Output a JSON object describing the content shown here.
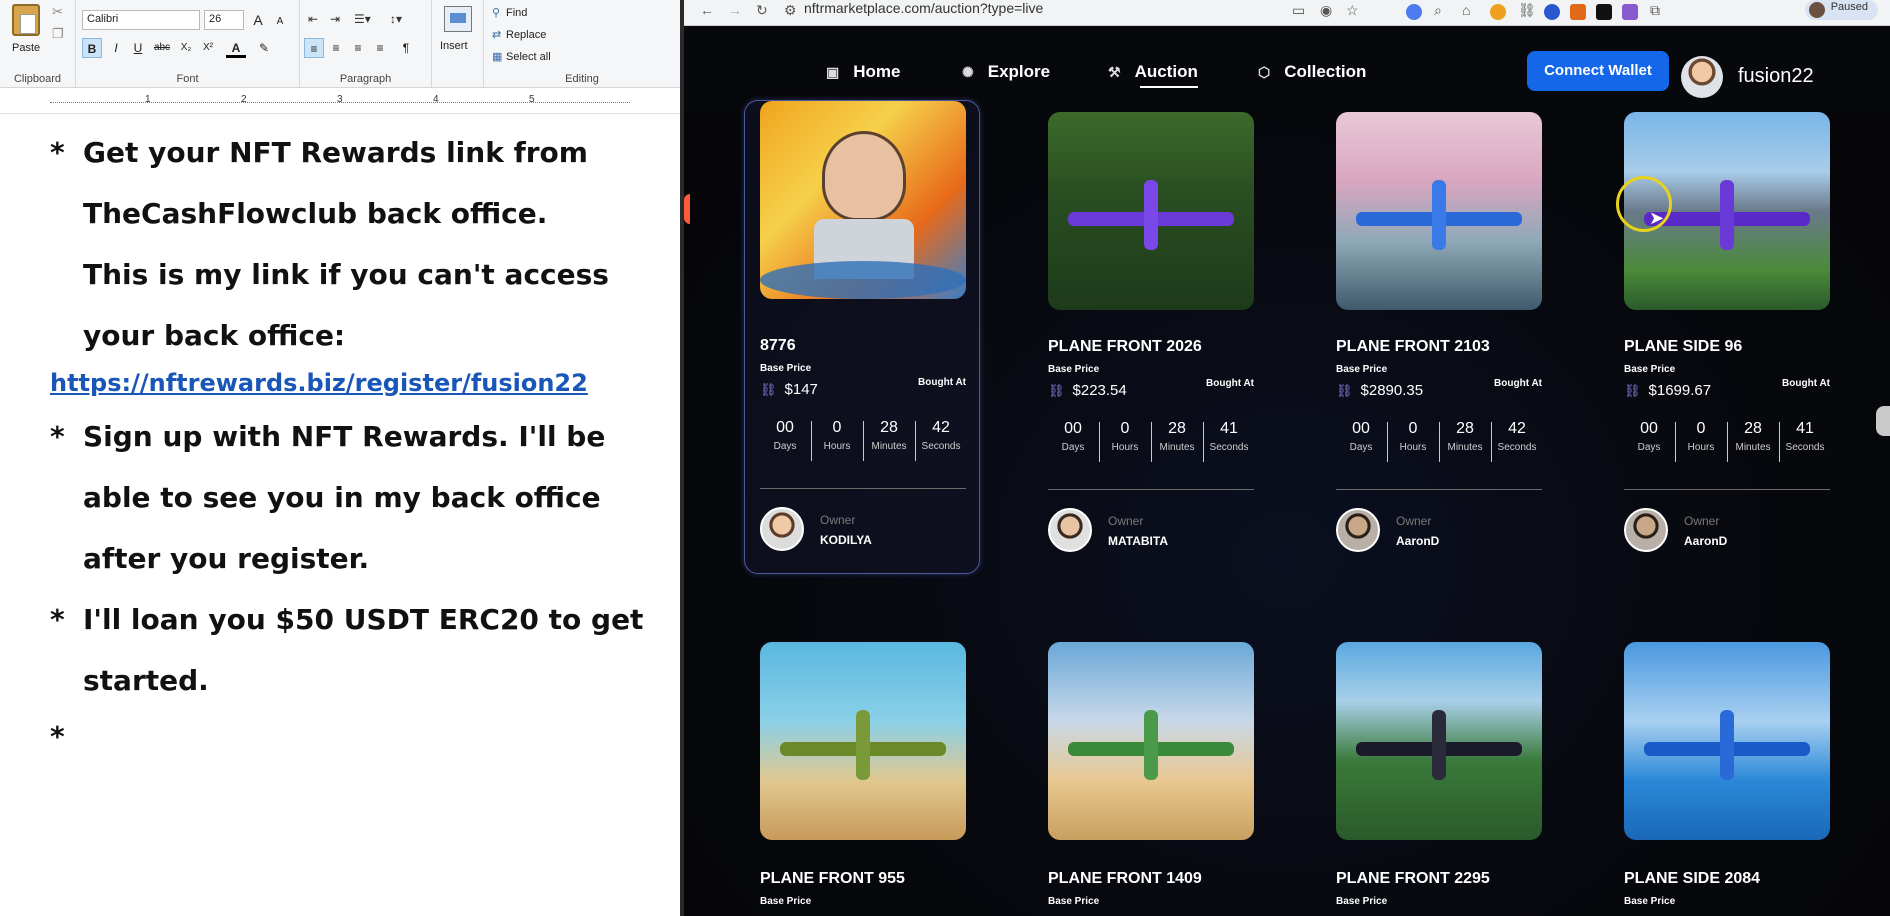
{
  "wordpad": {
    "ribbon": {
      "paste_label": "Paste",
      "clipboard_label": "Clipboard",
      "font_name": "Calibri",
      "font_size": "26",
      "font_label": "Font",
      "paragraph_label": "Paragraph",
      "insert_label": "Insert",
      "find_label": "Find",
      "replace_label": "Replace",
      "select_all_label": "Select all",
      "editing_label": "Editing",
      "bold": "B",
      "italic": "I",
      "underline": "U",
      "strike": "abc",
      "subscript": "X₂",
      "superscript": "X²",
      "font_color": "A",
      "grow_font": "A",
      "shrink_font": "A"
    },
    "ruler": [
      "1",
      "2",
      "3",
      "4",
      "5"
    ],
    "document": {
      "bullet": "*",
      "lines": [
        "Get your NFT Rewards link from",
        "TheCashFlowclub back office.",
        "This is my link if you can't access",
        "your back office:",
        "Sign up with NFT Rewards.  I'll be",
        "able to see you in my back office",
        "after you register.",
        "I'll loan you $50 USDT ERC20 to get",
        "started."
      ],
      "link": "https://nftrewards.biz/register/fusion22"
    }
  },
  "browser": {
    "url": "nftrmarketplace.com/auction?type=live",
    "paused_label": "Paused",
    "site": {
      "nav": {
        "home": "Home",
        "explore": "Explore",
        "auction": "Auction",
        "collection": "Collection"
      },
      "connect_wallet": "Connect Wallet",
      "username": "fusion22",
      "labels": {
        "base_price": "Base Price",
        "bought_at": "Bought At",
        "owner": "Owner",
        "days": "Days",
        "hours": "Hours",
        "minutes": "Minutes",
        "seconds": "Seconds"
      },
      "cards": [
        {
          "title": "8776",
          "price": "$147",
          "days": "00",
          "hours": "0",
          "minutes": "28",
          "seconds": "42",
          "owner": "KODILYA"
        },
        {
          "title": "PLANE FRONT 2026",
          "price": "$223.54",
          "days": "00",
          "hours": "0",
          "minutes": "28",
          "seconds": "41",
          "owner": "MATABITA"
        },
        {
          "title": "PLANE FRONT 2103",
          "price": "$2890.35",
          "days": "00",
          "hours": "0",
          "minutes": "28",
          "seconds": "42",
          "owner": "AaronD"
        },
        {
          "title": "PLANE SIDE 96",
          "price": "$1699.67",
          "days": "00",
          "hours": "0",
          "minutes": "28",
          "seconds": "41",
          "owner": "AaronD"
        },
        {
          "title": "PLANE FRONT 955"
        },
        {
          "title": "PLANE FRONT 1409"
        },
        {
          "title": "PLANE FRONT 2295"
        },
        {
          "title": "PLANE SIDE 2084"
        }
      ]
    }
  }
}
